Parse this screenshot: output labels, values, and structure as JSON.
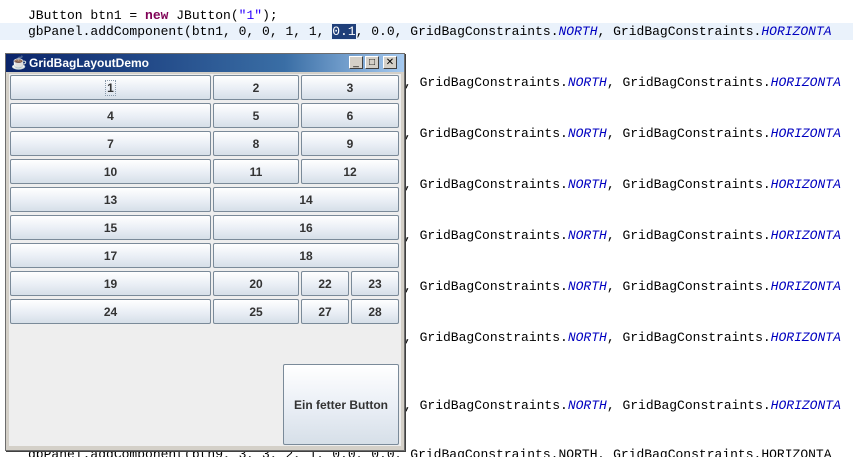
{
  "code": {
    "l1_a": "JButton btn1 = ",
    "l1_kw": "new",
    "l1_b": " JButton(",
    "l1_str": "\"1\"",
    "l1_c": ");",
    "l2_a": "gbPanel.addComponent(btn1, 0, 0, 1, 1, ",
    "l2_sel": "0.1",
    "l2_b": ", 0.0, GridBagConstraints.",
    "c_north": "NORTH",
    "sep": ", GridBagConstraints.",
    "c_horiz": "HORIZONTA",
    "tail_prefix": ", GridBagConstraints.",
    "last_line": "gbPanel.addComponent(btn9, 3, 3, 2, 1, 0.0, 0.0, GridBagConstraints.NORTH, GridBagConstraints.HORIZONTA"
  },
  "window": {
    "title": "GridBagLayoutDemo",
    "title_icon": "java-cup-icon",
    "minimize": "_",
    "maximize": "□",
    "close": "✕"
  },
  "buttons": [
    "1",
    "2",
    "3",
    "4",
    "5",
    "6",
    "7",
    "8",
    "9",
    "10",
    "11",
    "12",
    "13",
    "14",
    "15",
    "16",
    "17",
    "18",
    "19",
    "20",
    "22",
    "23",
    "24",
    "25",
    "27",
    "28"
  ],
  "big_button": "Ein fetter Button"
}
